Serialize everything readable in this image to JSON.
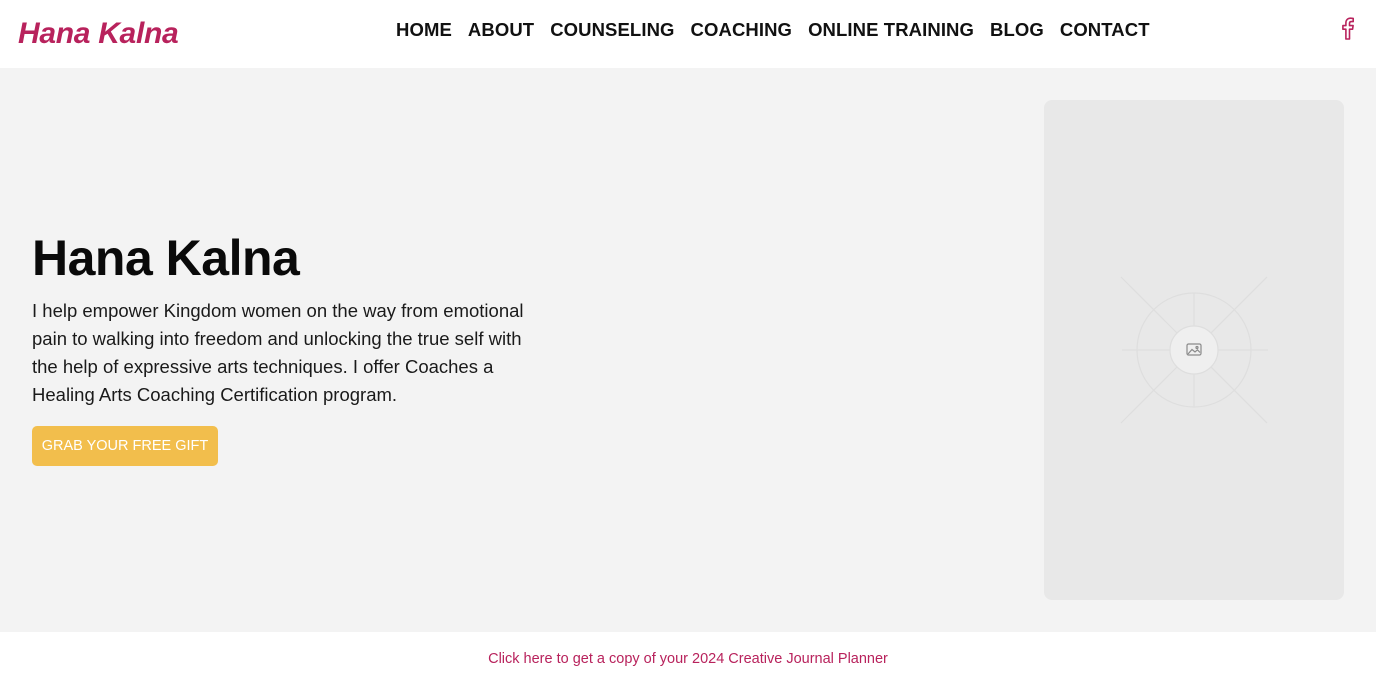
{
  "header": {
    "logo": "Hana Kalna",
    "nav": [
      "HOME",
      "ABOUT",
      "COUNSELING",
      "COACHING",
      "ONLINE TRAINING",
      "BLOG",
      "CONTACT"
    ],
    "social_icon": "facebook-icon"
  },
  "hero": {
    "title": "Hana Kalna",
    "text": "I help empower Kingdom women on the way from emotional pain to walking into freedom and unlocking the true self with the help of expressive arts techniques. I offer Coaches a Healing Arts Coaching Certification program.",
    "cta_label": "GRAB YOUR FREE GIFT",
    "image_icon": "image-placeholder-icon"
  },
  "footer": {
    "link_text": "Click here to get a copy of your 2024 Creative Journal Planner"
  },
  "colors": {
    "brand": "#b8225c",
    "cta": "#f2be4c",
    "hero_bg": "#f3f3f3",
    "image_bg": "#e8e8e8"
  }
}
